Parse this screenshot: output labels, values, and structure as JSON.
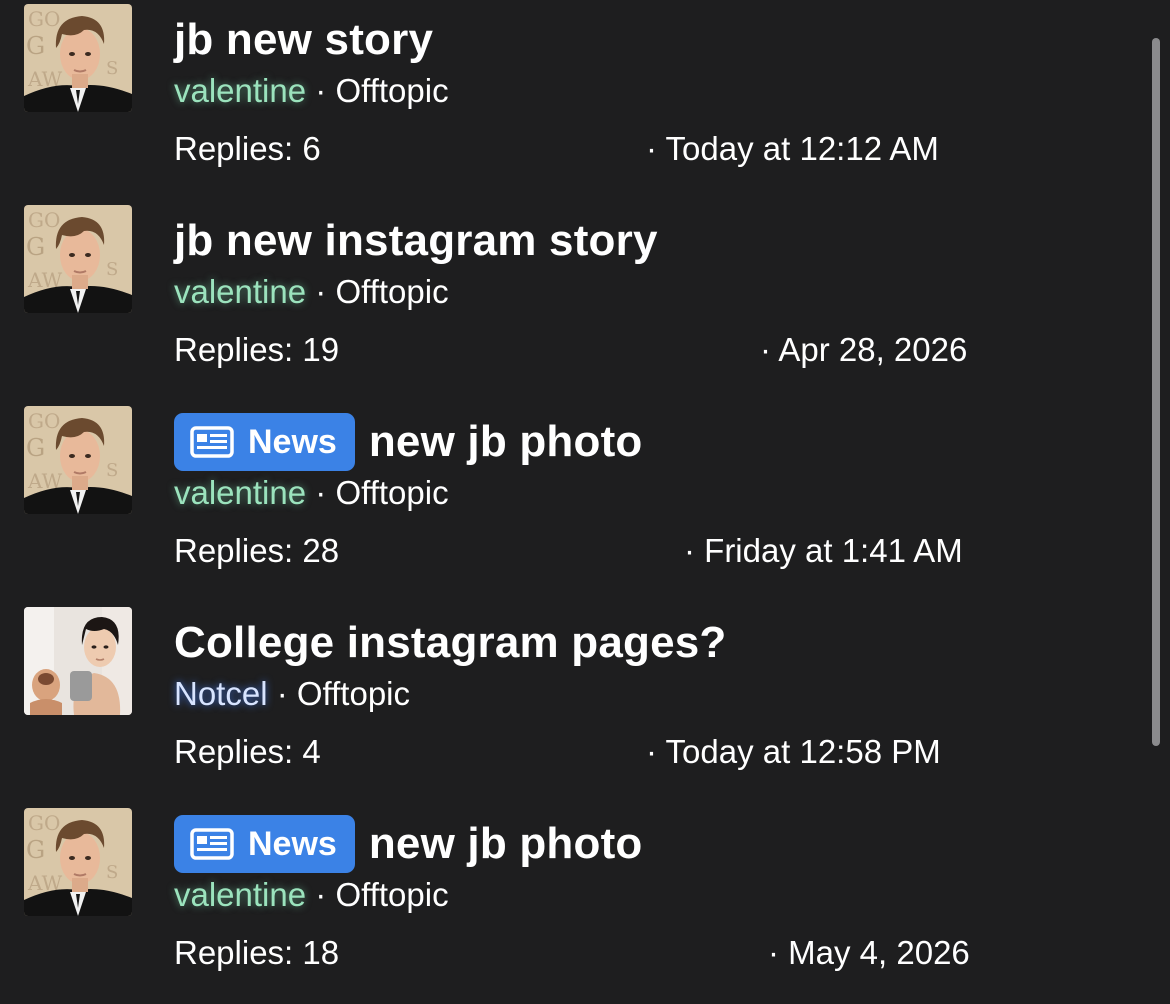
{
  "threads": [
    {
      "title": "jb new story",
      "prefix": "",
      "author": "valentine",
      "forum": "Offtopic",
      "separator": "·",
      "replies": "Replies: 6",
      "date": "· Today at 12:12 AM",
      "avatar": "avatar-formal-portrait"
    },
    {
      "title": "jb new instagram story",
      "prefix": "",
      "author": "valentine",
      "forum": "Offtopic",
      "separator": "·",
      "replies": "Replies: 19",
      "date": "· Apr 28, 2026",
      "avatar": "avatar-formal-portrait"
    },
    {
      "title": "new jb photo",
      "prefix": "News",
      "author": "valentine",
      "forum": "Offtopic",
      "separator": "·",
      "replies": "Replies: 28",
      "date": "· Friday at 1:41 AM",
      "avatar": "avatar-formal-portrait"
    },
    {
      "title": "College instagram pages?",
      "prefix": "",
      "author": "Notcel",
      "forum": "Offtopic",
      "separator": "·",
      "replies": "Replies: 4",
      "date": "· Today at 12:58 PM",
      "avatar": "avatar-casual-portrait"
    },
    {
      "title": "new jb photo",
      "prefix": "News",
      "author": "valentine",
      "forum": "Offtopic",
      "separator": "·",
      "replies": "Replies: 18",
      "date": "· May 4, 2026",
      "avatar": "avatar-formal-portrait"
    }
  ],
  "colors": {
    "background": "#1e1e1f",
    "news_badge": "#3b82e6",
    "author_valentine": "#9be3bd",
    "author_notcel": "#d8e4ff"
  },
  "icons": {
    "news_prefix": "newspaper-icon"
  }
}
